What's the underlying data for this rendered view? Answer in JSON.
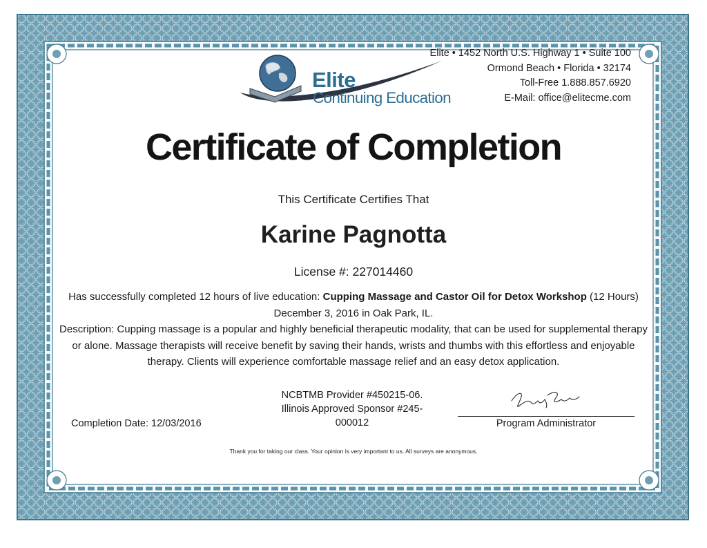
{
  "org": {
    "address_lines": [
      "Elite • 1452 North U.S. Highway 1 • Suite 100",
      "Ormond Beach • Florida • 32174",
      "Toll-Free 1.888.857.6920",
      "E-Mail: office@elitecme.com"
    ],
    "logo_name": "Elite",
    "logo_tagline": "Continuing Education"
  },
  "certificate": {
    "title": "Certificate of Completion",
    "certifies_text": "This Certificate Certifies That",
    "recipient_name": "Karine Pagnotta",
    "license_text": "License #: 227014460",
    "completed_prefix": "Has successfully completed 12 hours of live education: ",
    "course_title": "Cupping Massage and Castor Oil for Detox Workshop",
    "course_details": " (12 Hours) December 3, 2016 in Oak Park, IL.",
    "description": "Description: Cupping massage is a popular and highly beneficial therapeutic modality, that can be used for supplemental therapy or alone.  Massage therapists will receive benefit by saving their hands, wrists and thumbs with this effortless and enjoyable therapy.  Clients will experience comfortable massage relief and an easy detox application.",
    "provider_line1": "NCBTMB Provider #450215-06.",
    "provider_line2": "Illinois Approved Sponsor #245-",
    "provider_line3": "000012",
    "completion_date": "Completion Date: 12/03/2016",
    "signature_name": "Tracey Foster",
    "admin_label": "Program Administrator",
    "footer_note": "Thank you for taking our class. Your opinion is very important to us. All surveys are anonymous."
  },
  "colors": {
    "border": "#5d93a8",
    "border_dark": "#3e7790",
    "brand": "#2d6e93"
  }
}
